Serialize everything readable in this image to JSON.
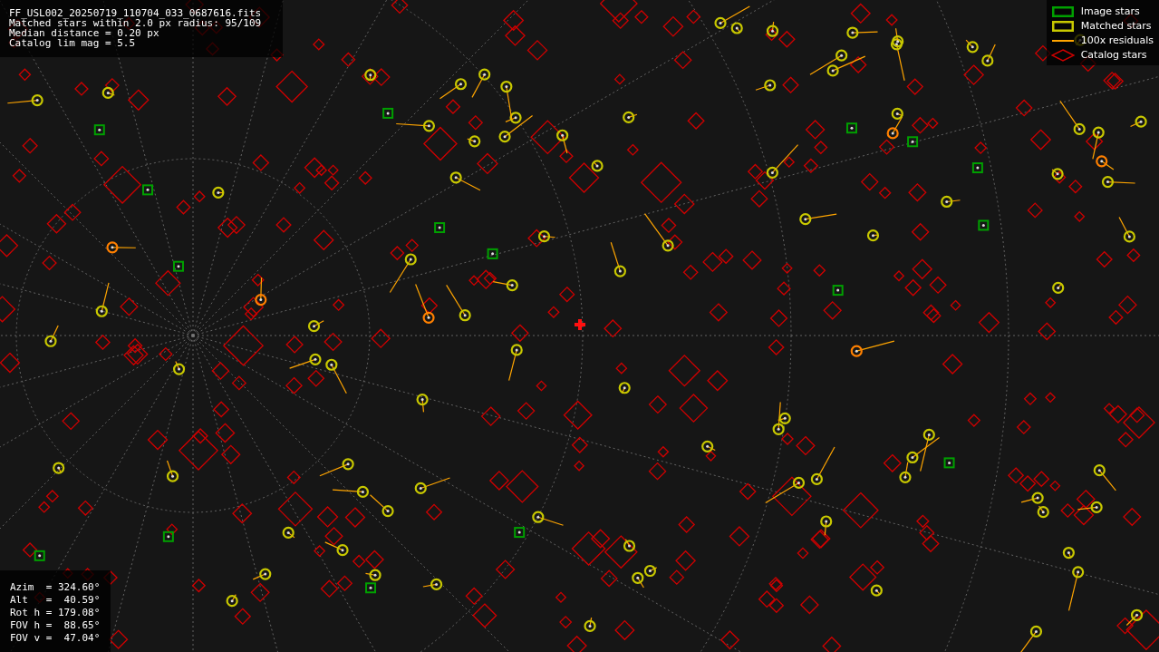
{
  "info": {
    "lines": [
      "FF_USL002_20250719_110704_033_0687616.fits",
      "Matched stars within 2.0 px radius: 95/109",
      "Median distance = 0.20 px",
      "Catalog lim mag = 5.5"
    ]
  },
  "legend": [
    {
      "label": "Image stars",
      "kind": "box",
      "color": "#00a000"
    },
    {
      "label": "Matched stars",
      "kind": "box",
      "color": "#c8c800"
    },
    {
      "label": "100x residuals",
      "kind": "line",
      "color": "#ffa500"
    },
    {
      "label": "Catalog stars",
      "kind": "diamond",
      "color": "#d00000"
    }
  ],
  "pointing": {
    "lines": [
      "Azim  = 324.60°",
      "Alt   =  40.59°",
      "Rot h = 179.08°",
      "FOV h =  88.65°",
      "FOV v =  47.04°"
    ]
  }
}
